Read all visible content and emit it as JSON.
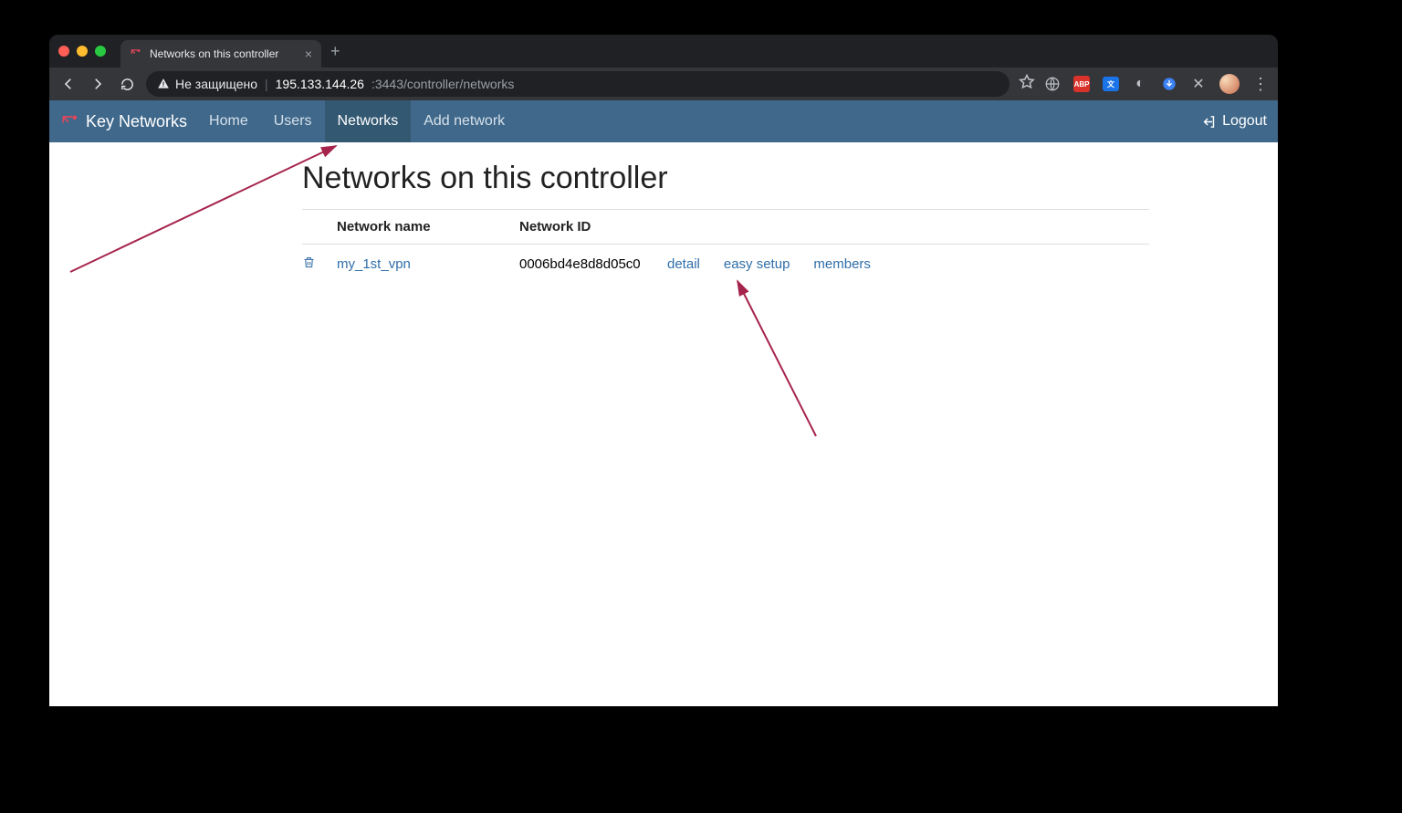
{
  "browser": {
    "tab_title": "Networks on this controller",
    "security_label": "Не защищено",
    "url_host": "195.133.144.26",
    "url_rest": ":3443/controller/networks"
  },
  "appnav": {
    "brand": "Key Networks",
    "links": {
      "home": "Home",
      "users": "Users",
      "networks": "Networks",
      "add_network": "Add network"
    },
    "logout": "Logout"
  },
  "page": {
    "title": "Networks on this controller",
    "headers": {
      "name": "Network name",
      "id": "Network ID"
    },
    "rows": [
      {
        "name": "my_1st_vpn",
        "id": "0006bd4e8d8d05c0",
        "detail": "detail",
        "easy_setup": "easy setup",
        "members": "members"
      }
    ]
  }
}
